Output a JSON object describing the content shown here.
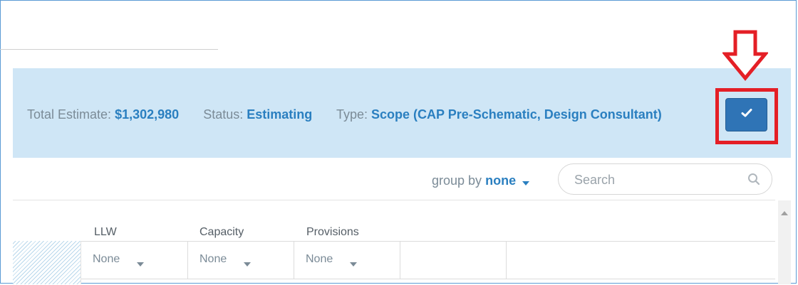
{
  "summary": {
    "total_estimate_label": "Total Estimate:",
    "total_estimate_value": "$1,302,980",
    "status_label": "Status:",
    "status_value": "Estimating",
    "type_label": "Type:",
    "type_value": "Scope (CAP Pre-Schematic, Design Consultant)",
    "confirm_icon": "checkmark-icon"
  },
  "annotation": {
    "arrow_icon": "down-arrow-icon",
    "highlight_color": "#e41f26"
  },
  "toolbar": {
    "group_by_label": "group by",
    "group_by_value": "none",
    "search_placeholder": "Search",
    "search_icon": "search-icon"
  },
  "grid": {
    "columns": [
      {
        "header": "LLW",
        "filter": "None"
      },
      {
        "header": "Capacity",
        "filter": "None"
      },
      {
        "header": "Provisions",
        "filter": "None"
      }
    ]
  },
  "colors": {
    "accent": "#2a7fc0",
    "summary_bg": "#cfe6f6",
    "button_bg": "#2f74b6",
    "frame_border": "#5b9bd5"
  }
}
